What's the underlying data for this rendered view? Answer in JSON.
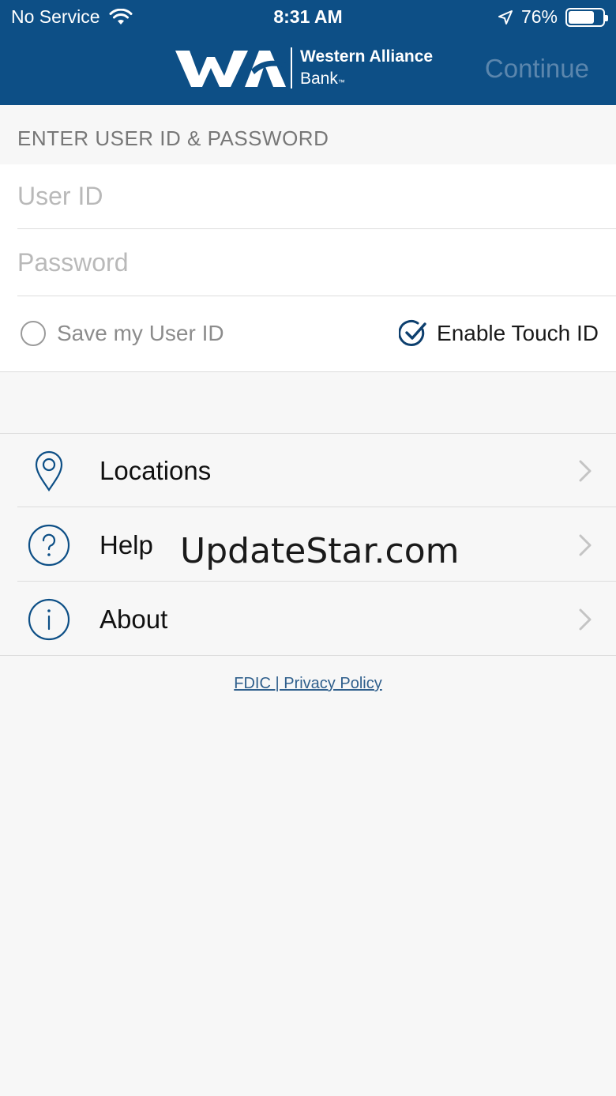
{
  "status_bar": {
    "carrier": "No Service",
    "time": "8:31 AM",
    "battery": "76%",
    "battery_level": 0.76
  },
  "header": {
    "brand_line1": "Western Alliance",
    "brand_line2": "Bank",
    "brand_tm": "™",
    "continue_label": "Continue",
    "background_color": "#0d4f86"
  },
  "login": {
    "section_label": "ENTER USER ID & PASSWORD",
    "userid_placeholder": "User ID",
    "userid_value": "",
    "password_placeholder": "Password",
    "password_value": "",
    "save_user_id_label": "Save my User ID",
    "save_user_id_checked": false,
    "touch_id_label": "Enable Touch ID",
    "touch_id_checked": true
  },
  "menu": {
    "items": [
      {
        "label": "Locations",
        "icon": "location-pin-icon"
      },
      {
        "label": "Help",
        "icon": "question-circle-icon"
      },
      {
        "label": "About",
        "icon": "info-circle-icon"
      }
    ]
  },
  "footer": {
    "links_text": "FDIC | Privacy Policy"
  },
  "watermark": "UpdateStar.com"
}
